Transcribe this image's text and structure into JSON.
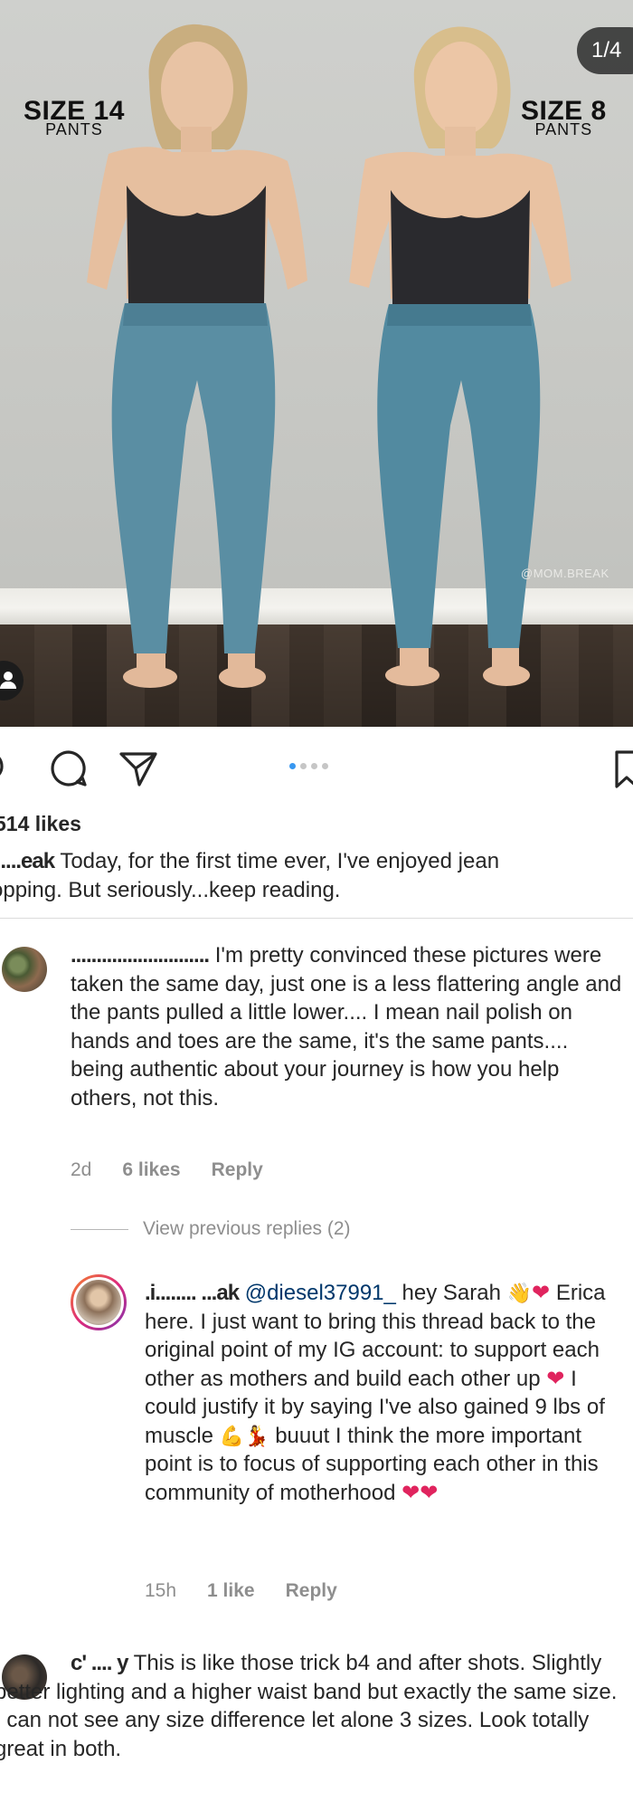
{
  "post": {
    "slide_counter": "1/4",
    "left_label": {
      "size": "SIZE 14",
      "item": "PANTS"
    },
    "right_label": {
      "size": "SIZE 8",
      "item": "PANTS"
    },
    "watermark": "@MOM.BREAK",
    "carousel": {
      "count": 4,
      "active_index": 0
    }
  },
  "likes": "514 likes",
  "caption": {
    "username": "'.....eak",
    "text": "Today, for the first time ever, I've enjoyed jean",
    "text_line2": "opping. But seriously...keep reading."
  },
  "comments": [
    {
      "username": "...........................",
      "text_line1": "I'm pretty",
      "text": "convinced these pictures were taken the same day, just one is a less flattering angle and the pants pulled a little lower.... I mean nail polish on hands and toes are the same, it's the same pants.... being authentic about your journey is how you help others, not this.",
      "time": "2d",
      "likes": "6 likes",
      "reply_label": "Reply"
    },
    {
      "view_replies": "View previous replies (2)"
    },
    {
      "username": ".i........ ...ak",
      "mention": "@diesel37991_",
      "text_a": "hey Sarah",
      "text_b": "Erica here. I just want to bring this thread back to the original point of my IG account: to support each other as mothers and build each other up",
      "text_c": "I could justify it by saying I've also gained 9 lbs of muscle",
      "text_d": "buuut I think the more important point is to focus of supporting each other in this community of motherhood",
      "time": "15h",
      "likes": "1 like",
      "reply_label": "Reply"
    },
    {
      "username": "c' .... y",
      "text": "This is like those trick b4 and after shots. Slightly better lighting and a higher waist band but exactly the same size. I can not see any size difference let alone 3 sizes. Look totally great in both."
    }
  ],
  "colors": {
    "accent_blue": "#3897f0",
    "heart_red": "#e0245e",
    "meta_gray": "#8e8e8e",
    "text": "#262626"
  }
}
